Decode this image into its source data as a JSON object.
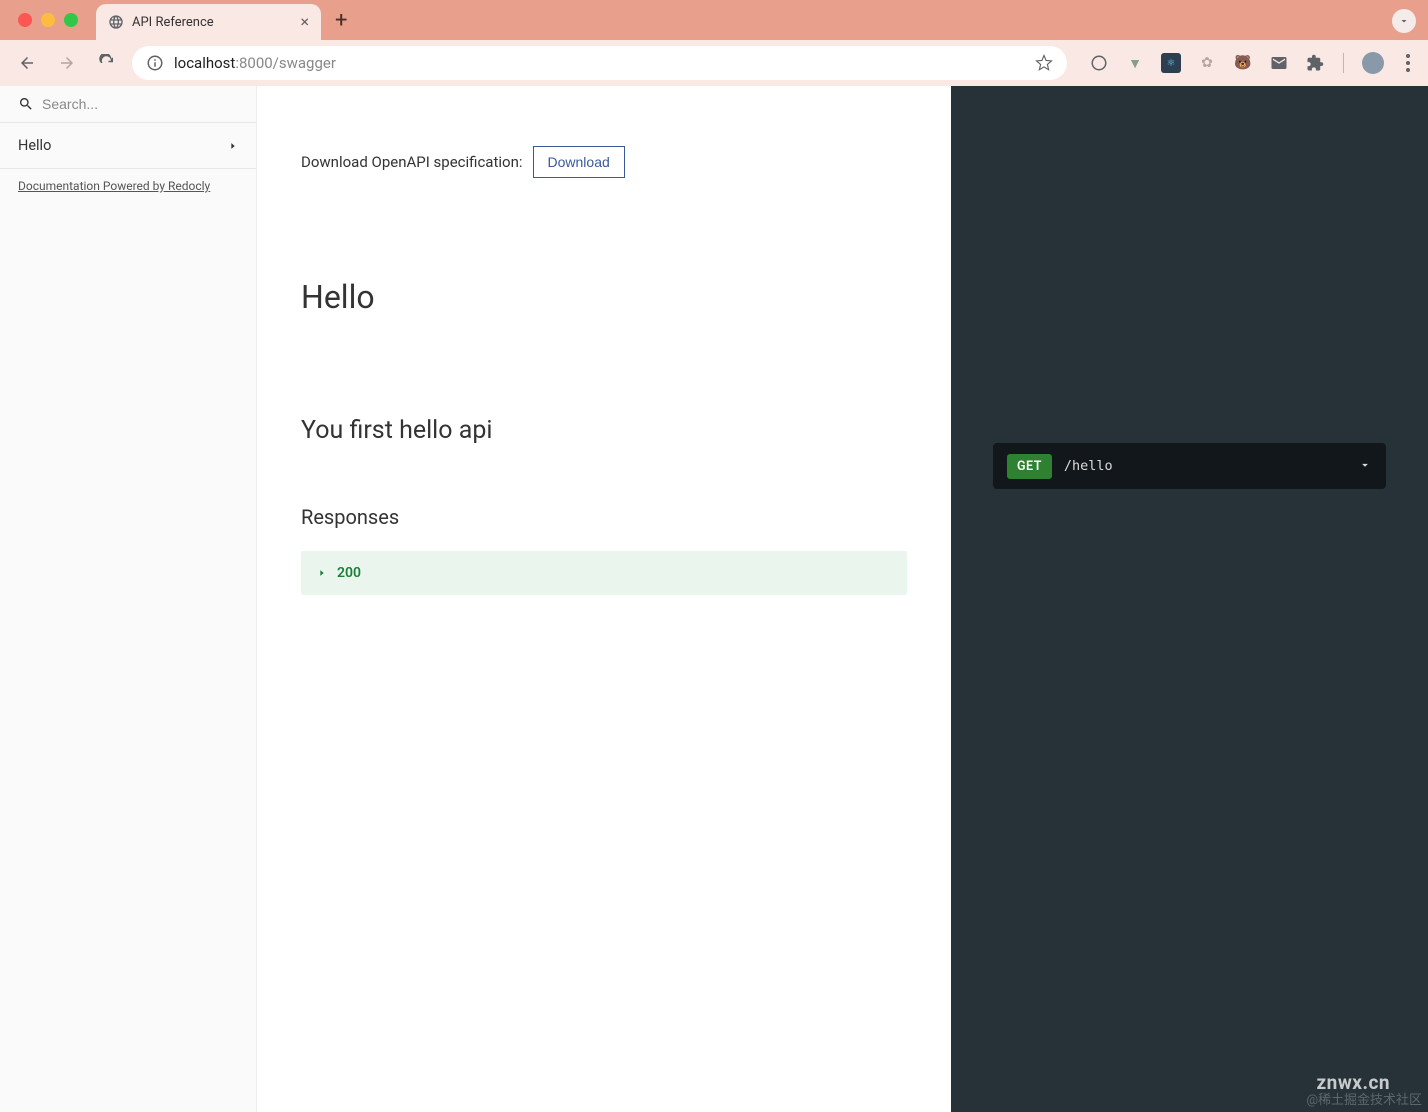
{
  "browser": {
    "tab_title": "API Reference",
    "url_host": "localhost",
    "url_port_path": ":8000/swagger"
  },
  "sidebar": {
    "search_placeholder": "Search...",
    "items": [
      {
        "label": "Hello"
      }
    ],
    "powered_by": "Documentation Powered by Redocly"
  },
  "content": {
    "download_label": "Download OpenAPI specification:",
    "download_button": "Download",
    "section_title": "Hello",
    "operation_title": "You first hello api",
    "responses_heading": "Responses",
    "responses": [
      {
        "code": "200"
      }
    ]
  },
  "request": {
    "method": "GET",
    "path": "/hello"
  },
  "watermarks": {
    "w1": "znwx.cn",
    "w2": "@稀土掘金技术社区"
  }
}
